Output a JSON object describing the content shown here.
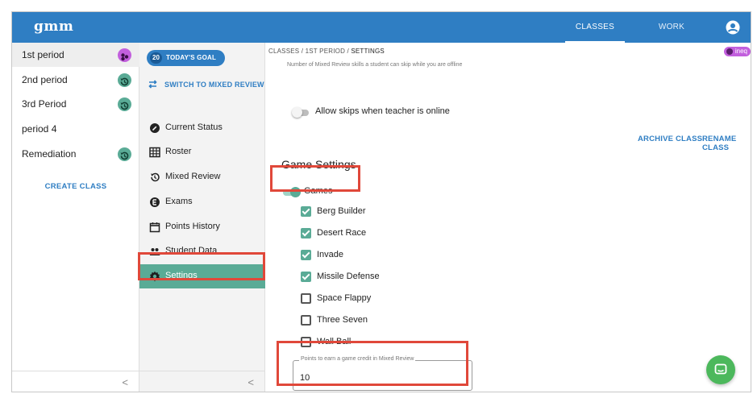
{
  "brand": {
    "logo": "gmm",
    "primary": "#2f7ec3",
    "accent": "#5aab96",
    "highlight": "#e0483a"
  },
  "topnav": {
    "classes": "CLASSES",
    "work": "WORK",
    "user_icon": "account-circle-icon"
  },
  "classes": [
    {
      "name": "1st period",
      "badge": "purple-dots",
      "active": true
    },
    {
      "name": "2nd period",
      "badge": "history"
    },
    {
      "name": "3rd Period",
      "badge": "history"
    },
    {
      "name": "period 4",
      "badge": ""
    },
    {
      "name": "Remediation",
      "badge": "history"
    }
  ],
  "create_class": "CREATE CLASS",
  "menu": {
    "goal_count": "20",
    "goal_label": "TODAY'S GOAL",
    "switch_label": "SWITCH TO MIXED REVIEW",
    "items": [
      {
        "label": "Current Status",
        "icon": "gauge-icon"
      },
      {
        "label": "Roster",
        "icon": "grid-icon"
      },
      {
        "label": "Mixed Review",
        "icon": "history-icon"
      },
      {
        "label": "Exams",
        "icon": "exam-icon"
      },
      {
        "label": "Points History",
        "icon": "calendar-icon"
      },
      {
        "label": "Student Data",
        "icon": "people-icon"
      },
      {
        "label": "Settings",
        "icon": "gear-icon",
        "active": true
      }
    ]
  },
  "breadcrumb": {
    "root": "CLASSES",
    "sep": "/",
    "class": "1ST PERIOD",
    "page": "SETTINGS"
  },
  "class_chip": "ineq",
  "settings": {
    "help_text": "Number of Mixed Review skills a student can skip while you are offline",
    "allow_skips_label": "Allow skips when teacher is online",
    "allow_skips_on": false,
    "archive_label": "ARCHIVE CLASS",
    "rename_label": "RENAME CLASS",
    "game_settings_title": "Game Settings",
    "games_label": "Games",
    "games_on": true,
    "games": [
      {
        "label": "Berg Builder",
        "checked": true
      },
      {
        "label": "Desert Race",
        "checked": true
      },
      {
        "label": "Invade",
        "checked": true
      },
      {
        "label": "Missile Defense",
        "checked": true
      },
      {
        "label": "Space Flappy",
        "checked": false
      },
      {
        "label": "Three Seven",
        "checked": false
      },
      {
        "label": "Wall Ball",
        "checked": false
      }
    ],
    "points_field_label": "Points to earn a game credit in Mixed Review",
    "points_field_value": "10"
  },
  "collapse_glyph": "<",
  "chat_icon": "chat-icon"
}
